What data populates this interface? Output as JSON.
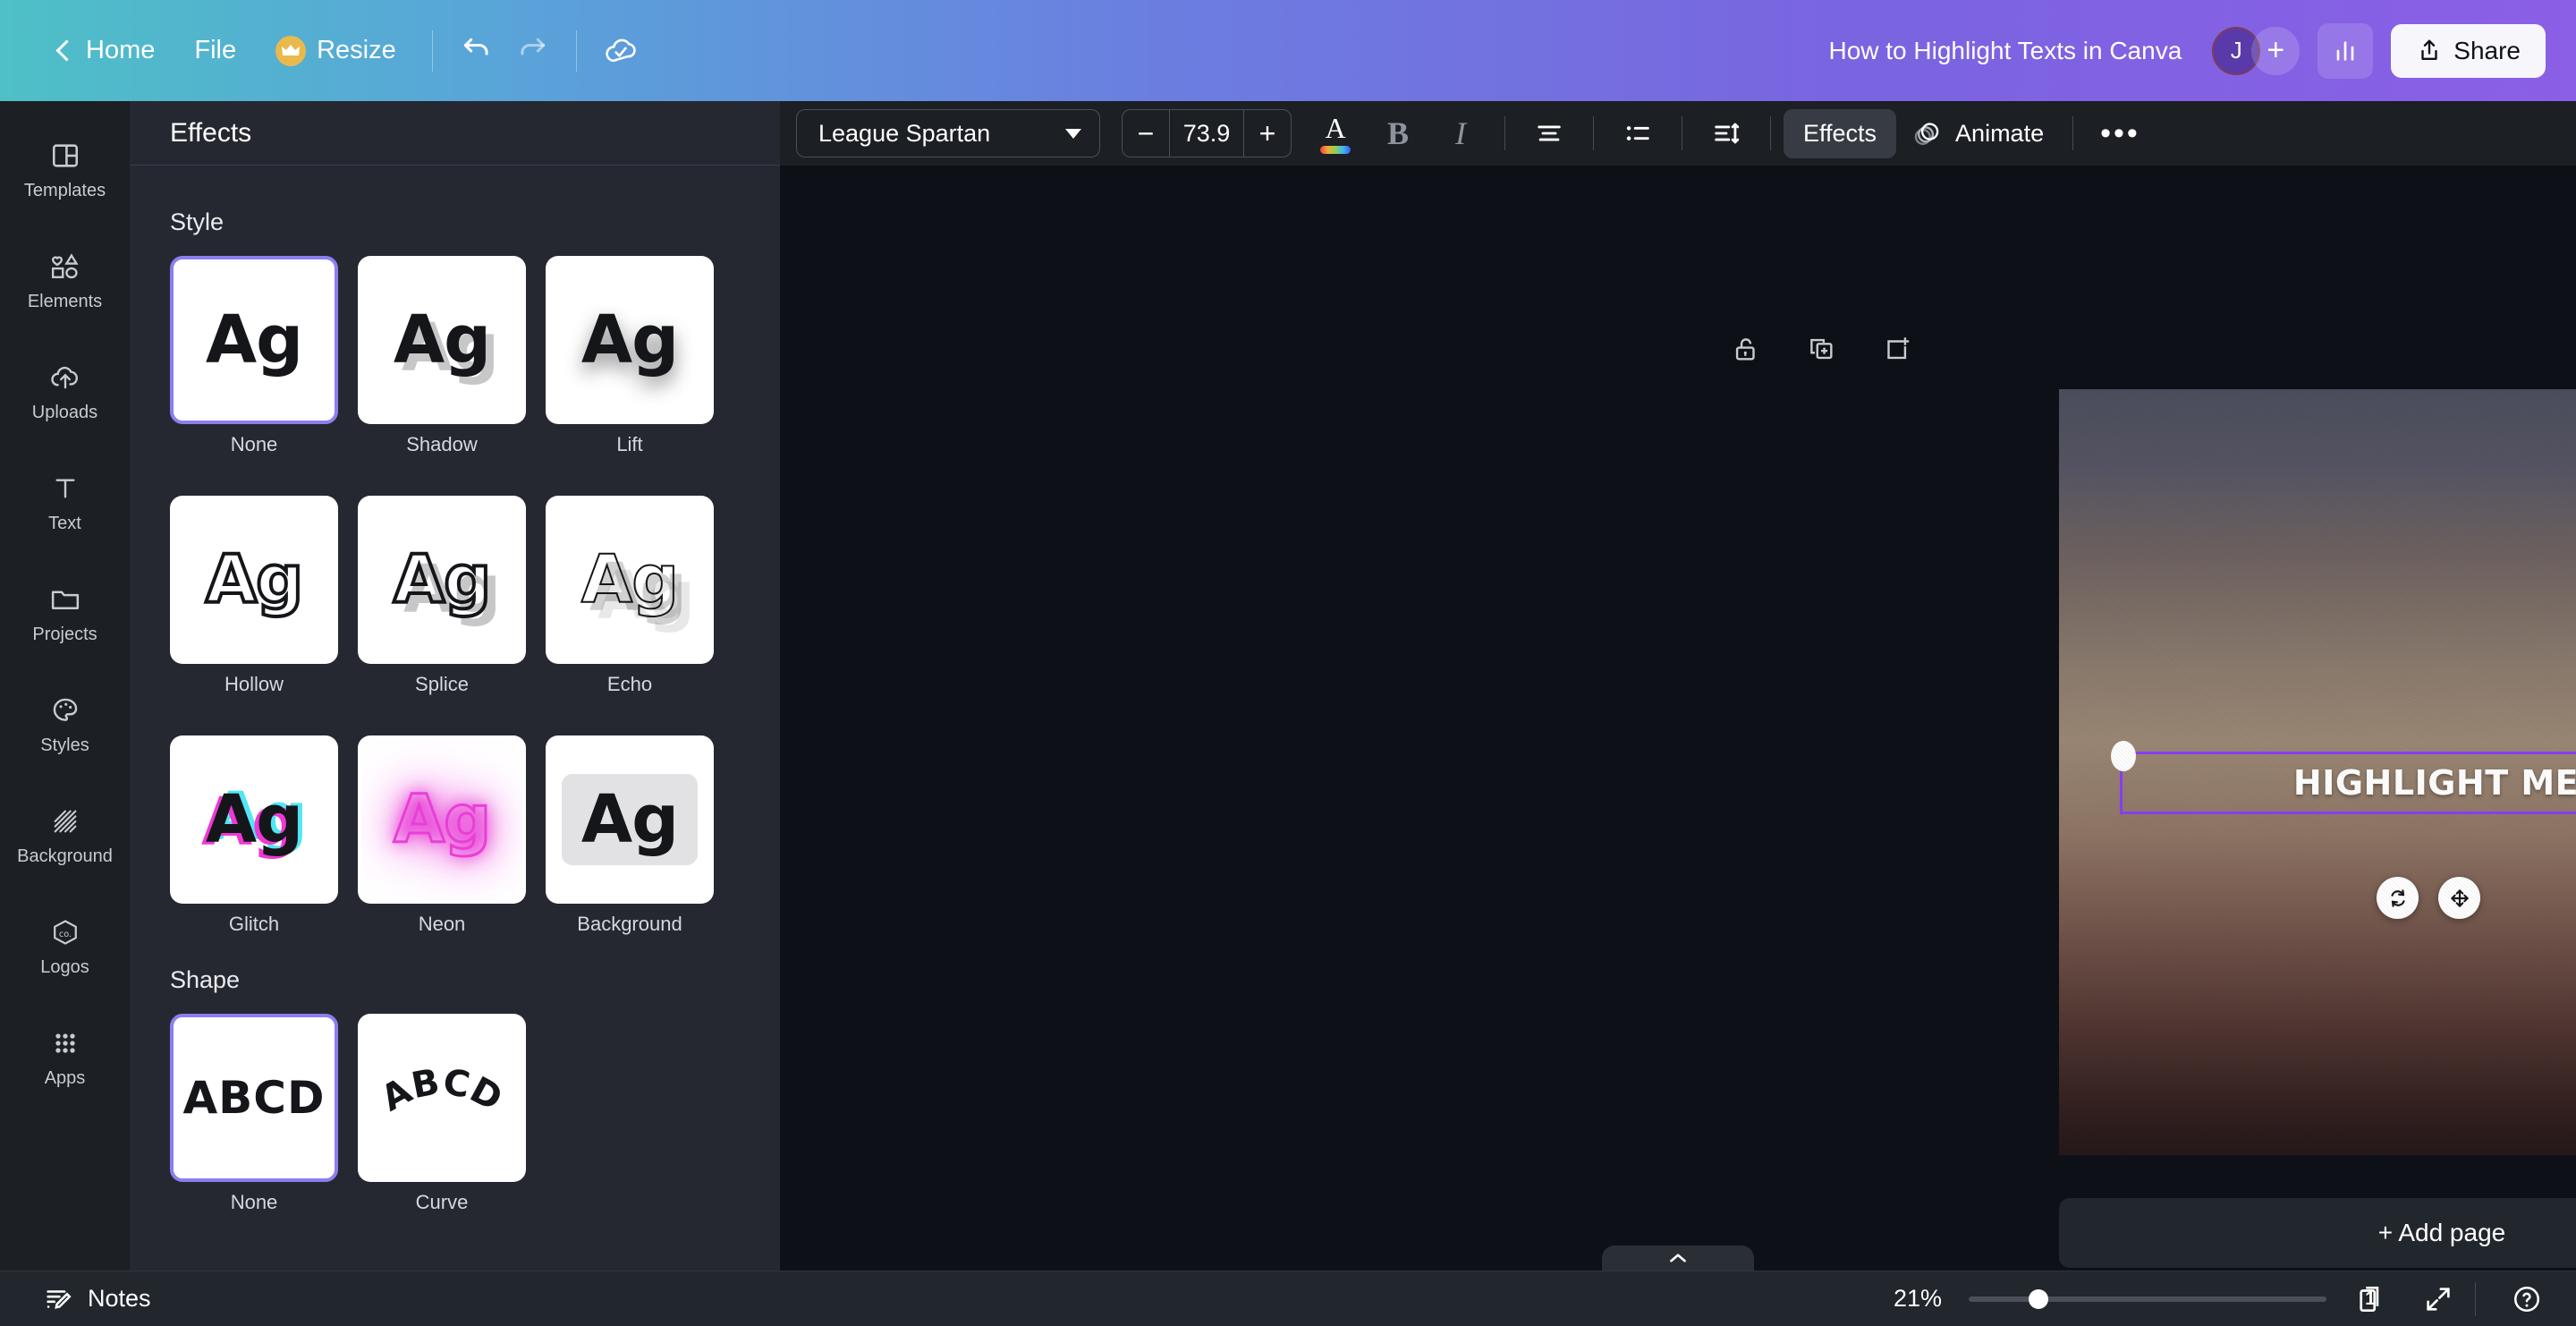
{
  "topbar": {
    "back_label": "Home",
    "file_label": "File",
    "resize_label": "Resize",
    "crown_icon": "crown-icon",
    "undo_icon": "undo-icon",
    "redo_icon": "redo-icon",
    "cloud_saved_icon": "cloud-check-icon",
    "doc_title": "How to Highlight Texts in Canva",
    "avatar_initial": "J",
    "add_member_label": "+",
    "insights_icon": "insights-bar-chart-icon",
    "share_label": "Share",
    "share_icon": "share-upload-icon"
  },
  "rail": {
    "items": [
      {
        "label": "Templates",
        "icon": "templates-icon"
      },
      {
        "label": "Elements",
        "icon": "elements-icon"
      },
      {
        "label": "Uploads",
        "icon": "uploads-cloud-icon"
      },
      {
        "label": "Text",
        "icon": "text-t-icon"
      },
      {
        "label": "Projects",
        "icon": "projects-folder-icon"
      },
      {
        "label": "Styles",
        "icon": "styles-palette-icon"
      },
      {
        "label": "Background",
        "icon": "background-hatch-icon"
      },
      {
        "label": "Logos",
        "icon": "logos-hex-icon"
      },
      {
        "label": "Apps",
        "icon": "apps-grid-icon"
      }
    ]
  },
  "panel": {
    "title": "Effects",
    "style_section": "Style",
    "styles": [
      {
        "label": "None",
        "sample": "Ag",
        "selected": true
      },
      {
        "label": "Shadow",
        "sample": "Ag",
        "selected": false
      },
      {
        "label": "Lift",
        "sample": "Ag",
        "selected": false
      },
      {
        "label": "Hollow",
        "sample": "Ag",
        "selected": false
      },
      {
        "label": "Splice",
        "sample": "Ag",
        "selected": false
      },
      {
        "label": "Echo",
        "sample": "Ag",
        "selected": false
      },
      {
        "label": "Glitch",
        "sample": "Ag",
        "selected": false
      },
      {
        "label": "Neon",
        "sample": "Ag",
        "selected": false
      },
      {
        "label": "Background",
        "sample": "Ag",
        "selected": false
      }
    ],
    "shape_section": "Shape",
    "shapes": [
      {
        "label": "None",
        "sample": "ABCD",
        "selected": true
      },
      {
        "label": "Curve",
        "sample": "ABCD",
        "selected": false
      }
    ]
  },
  "toolbar": {
    "font_family": "League Spartan",
    "font_size": "73.9",
    "decrease_label": "−",
    "increase_label": "+",
    "text_color_icon": "text-color-a-icon",
    "bold_label": "B",
    "italic_label": "I",
    "align_icon": "align-center-icon",
    "list_icon": "bulleted-list-icon",
    "spacing_icon": "line-spacing-icon",
    "effects_label": "Effects",
    "animate_label": "Animate",
    "animate_icon": "animate-circles-icon",
    "more_label": "•••"
  },
  "page_tools": {
    "lock_icon": "unlock-icon",
    "duplicate_icon": "duplicate-page-icon",
    "add_page_icon": "add-page-icon"
  },
  "canvas": {
    "text_value": "HIGHLIGHT ME.",
    "selection_color": "#8b3dfc",
    "rotate_icon": "rotate-icon",
    "move_icon": "move-icon",
    "comment_icon": "add-comment-icon",
    "add_page_label": "+ Add page",
    "collapse_icon": "chevron-up-icon"
  },
  "bottombar": {
    "notes_label": "Notes",
    "notes_icon": "notes-pencil-icon",
    "zoom_label": "21%",
    "page_number": "1",
    "pages_icon": "page-stack-icon",
    "fullscreen_icon": "expand-icon",
    "help_icon": "help-question-icon"
  }
}
